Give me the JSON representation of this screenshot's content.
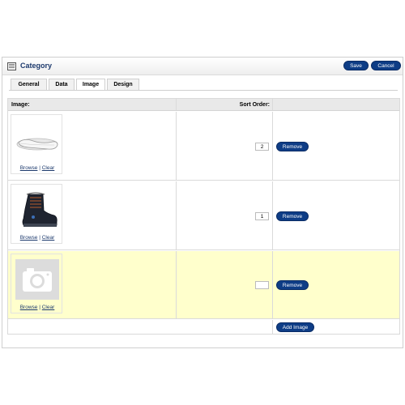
{
  "header": {
    "title": "Category",
    "save_label": "Save",
    "cancel_label": "Cancel"
  },
  "tabs": [
    {
      "label": "General",
      "active": false
    },
    {
      "label": "Data",
      "active": false
    },
    {
      "label": "Image",
      "active": true
    },
    {
      "label": "Design",
      "active": false
    }
  ],
  "table": {
    "col_image": "Image:",
    "col_sort": "Sort Order:",
    "rows": [
      {
        "image": "sandal-insole-thumbnail",
        "sort_order": "2",
        "browse": "Browse",
        "separator": "|",
        "clear": "Clear",
        "remove": "Remove"
      },
      {
        "image": "boot-thumbnail",
        "sort_order": "1",
        "browse": "Browse",
        "separator": "|",
        "clear": "Clear",
        "remove": "Remove"
      },
      {
        "image": "camera-placeholder-thumbnail",
        "sort_order": "",
        "browse": "Browse",
        "separator": "|",
        "clear": "Clear",
        "remove": "Remove",
        "highlighted": true
      }
    ],
    "add_image_label": "Add Image"
  },
  "colors": {
    "accent": "#0e3d86",
    "title": "#1d3a6d",
    "highlight_row": "#ffffcc"
  }
}
